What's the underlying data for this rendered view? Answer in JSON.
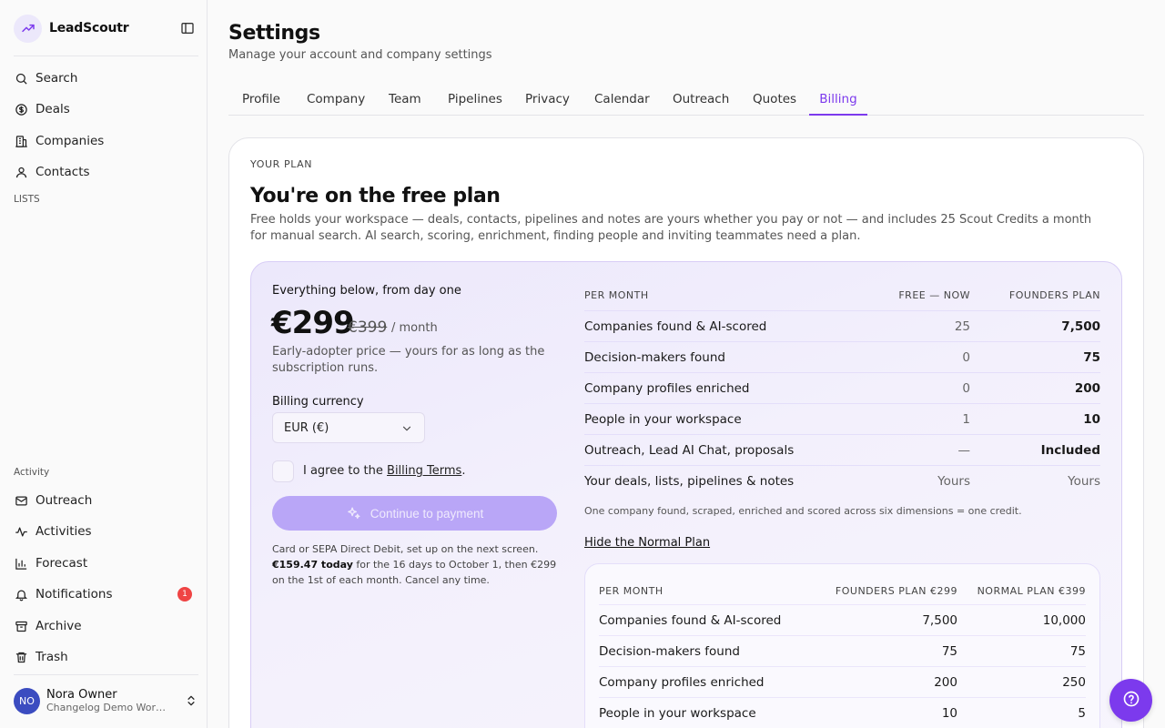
{
  "app": {
    "name": "LeadScoutr"
  },
  "sidebar": {
    "main_items": [
      {
        "label": "Search",
        "icon": "search-icon"
      },
      {
        "label": "Deals",
        "icon": "dollar-icon"
      },
      {
        "label": "Companies",
        "icon": "building-icon"
      },
      {
        "label": "Contacts",
        "icon": "user-icon"
      }
    ],
    "lists_label": "LISTS",
    "activity_label": "Activity",
    "activity_items": [
      {
        "label": "Outreach",
        "icon": "mail-icon"
      },
      {
        "label": "Activities",
        "icon": "activity-icon"
      },
      {
        "label": "Forecast",
        "icon": "bar-chart-icon"
      },
      {
        "label": "Notifications",
        "icon": "bell-icon",
        "badge": "1"
      },
      {
        "label": "Archive",
        "icon": "archive-icon"
      },
      {
        "label": "Trash",
        "icon": "trash-icon"
      }
    ],
    "user": {
      "initials": "NO",
      "name": "Nora Owner",
      "workspace": "Changelog Demo Workspace"
    }
  },
  "header": {
    "title": "Settings",
    "subtitle": "Manage your account and company settings",
    "tabs": [
      "Profile",
      "Company",
      "Team",
      "Pipelines",
      "Privacy",
      "Calendar",
      "Outreach",
      "Quotes",
      "Billing"
    ],
    "active_tab": "Billing"
  },
  "plan": {
    "eyebrow": "YOUR PLAN",
    "title": "You're on the free plan",
    "description": "Free holds your workspace — deals, contacts, pipelines and notes are yours whether you pay or not — and includes 25 Scout Credits a month for manual search. AI search, scoring, enrichment, finding people and inviting teammates need a plan.",
    "everything_label": "Everything below, from day one",
    "price": "€299",
    "old_price": "€399",
    "per_month": "/ month",
    "early_note": "Early-adopter price — yours for as long as the subscription runs.",
    "currency_label": "Billing currency",
    "currency_value": "EUR (€)",
    "agree_prefix": "I agree to the ",
    "agree_link": "Billing Terms",
    "agree_suffix": ".",
    "pay_button": "Continue to payment",
    "pay_note_1": "Card or SEPA Direct Debit, set up on the next screen.",
    "pay_note_bold": "€159.47 today",
    "pay_note_2": " for the 16 days to October 1, then €299 on the 1st of each month. Cancel any time."
  },
  "comparison": {
    "headers": [
      "PER MONTH",
      "FREE — NOW",
      "FOUNDERS PLAN"
    ],
    "rows": [
      [
        "Companies found & AI-scored",
        "25",
        "7,500"
      ],
      [
        "Decision-makers found",
        "0",
        "75"
      ],
      [
        "Company profiles enriched",
        "0",
        "200"
      ],
      [
        "People in your workspace",
        "1",
        "10"
      ],
      [
        "Outreach, Lead AI Chat, proposals",
        "—",
        "Included"
      ],
      [
        "Your deals, lists, pipelines & notes",
        "Yours",
        "Yours"
      ]
    ],
    "footnote": "One company found, scraped, enriched and scored across six dimensions = one credit.",
    "hide_link": "Hide the Normal Plan"
  },
  "normal_comparison": {
    "headers": [
      "PER MONTH",
      "FOUNDERS PLAN €299",
      "NORMAL PLAN €399"
    ],
    "rows": [
      [
        "Companies found & AI-scored",
        "7,500",
        "10,000"
      ],
      [
        "Decision-makers found",
        "75",
        "75"
      ],
      [
        "Company profiles enriched",
        "200",
        "250"
      ],
      [
        "People in your workspace",
        "10",
        "5"
      ]
    ]
  },
  "colors": {
    "accent": "#7c3aed",
    "accent_soft": "#b9a6f7",
    "badge": "#ef4444",
    "avatar": "#3b4cc0"
  }
}
